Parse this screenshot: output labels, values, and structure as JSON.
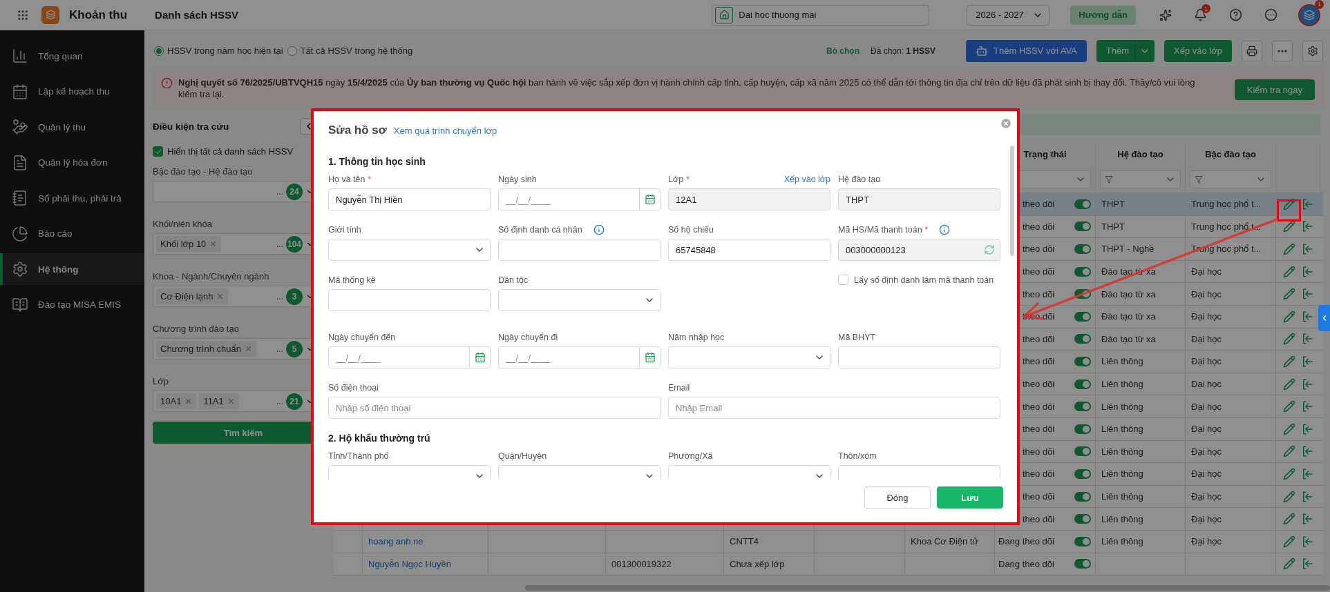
{
  "app": {
    "title": "Khoản thu",
    "page_title": "Danh sách HSSV"
  },
  "top_bar": {
    "school": "Dai hoc thuong mai",
    "year": "2026 - 2027",
    "guide_button": "Hướng dẫn",
    "notification_badge": "1",
    "avatar_badge": "1"
  },
  "sidebar": {
    "items": [
      {
        "kind": "overview",
        "label": "Tổng quan",
        "selected": false
      },
      {
        "kind": "plan",
        "label": "Lập kế hoạch thu",
        "selected": false
      },
      {
        "kind": "collect",
        "label": "Quản lý thu",
        "selected": false
      },
      {
        "kind": "invoice",
        "label": "Quản lý hóa đơn",
        "selected": false
      },
      {
        "kind": "ledger",
        "label": "Sổ phải thu, phải trả",
        "selected": false
      },
      {
        "kind": "report",
        "label": "Báo cáo",
        "selected": false
      },
      {
        "kind": "system",
        "label": "Hệ thống",
        "selected": true
      },
      {
        "kind": "training",
        "label": "Đào tạo MISA EMIS",
        "selected": false
      }
    ]
  },
  "toolbar": {
    "scope_options": [
      {
        "label": "HSSV trong năm học hiện tại",
        "selected": true
      },
      {
        "label": "Tất cả HSSV trong hệ thống",
        "selected": false
      }
    ],
    "clear_selection": "Bỏ chọn",
    "selected_count": "Đã chọn: **1 HSSV**",
    "buttons": [
      {
        "kind": "ava",
        "label": "Thêm HSSV với AVA"
      },
      {
        "kind": "split",
        "label": "Thêm"
      },
      {
        "kind": "primary",
        "label": "Xếp vào lớp"
      }
    ]
  },
  "notice": {
    "text": "**Nghị quyết số 76/2025/UBTVQH15** ngày **15/4/2025** của **Ủy ban thường vụ Quốc hội** ban hành về việc sắp xếp đơn vị hành chính cấp tỉnh, cấp huyện, cấp xã năm 2025 có thể dẫn tới thông tin địa chỉ trên dữ liệu đã phát sinh bị thay đổi. Thầy/cô vui lòng kiểm tra lại.",
    "action": "Kiểm tra ngay"
  },
  "filters": {
    "title": "Điều kiện tra cứu",
    "show_all": {
      "label": "Hiển thị tất cả danh sách HSSV",
      "checked": true
    },
    "fields": [
      {
        "label": "Bậc đào tạo - Hệ đào tạo",
        "more": "...",
        "count": "24"
      },
      {
        "label": "Khối/niên khóa",
        "tags": [
          "Khối lớp 10"
        ],
        "more": "...",
        "count": "104"
      },
      {
        "label": "Khoa - Ngành/Chuyên ngành",
        "tags": [
          "Cơ Điện lạnh"
        ],
        "more": "...",
        "count": "3"
      },
      {
        "label": "Chương trình đào tạo",
        "tags": [
          "Chương trình chuẩn"
        ],
        "more": "...",
        "count": "5"
      },
      {
        "label": "Lớp",
        "tags": [
          "10A1",
          "11A1"
        ],
        "more": "...",
        "count": "21"
      }
    ],
    "search_button": "Tìm kiếm"
  },
  "table": {
    "columns": [
      {
        "label": "Trạng thái"
      },
      {
        "label": "Hệ đào tạo",
        "filter": true
      },
      {
        "label": "Bậc đào tạo",
        "filter": true
      }
    ],
    "rows": [
      {
        "kind": "clipped",
        "selected": true,
        "status": "theo dõi",
        "on": true,
        "training_system": "THPT",
        "education_level": "Trung học phổ t..."
      },
      {
        "kind": "clipped",
        "selected": false,
        "status": "theo dõi",
        "on": true,
        "training_system": "THPT",
        "education_level": "Trung học phổ t..."
      },
      {
        "kind": "clipped",
        "selected": false,
        "status": "theo dõi",
        "on": true,
        "training_system": "THPT - Nghề",
        "education_level": "Trung học phổ t..."
      },
      {
        "kind": "clipped",
        "selected": false,
        "status": "theo dõi",
        "on": true,
        "training_system": "Đào tạo từ xa",
        "education_level": "Đại học"
      },
      {
        "kind": "clipped",
        "selected": false,
        "status": "theo dõi",
        "on": true,
        "training_system": "Đào tạo từ xa",
        "education_level": "Đại học"
      },
      {
        "kind": "clipped",
        "selected": false,
        "status": "theo dõi",
        "on": true,
        "training_system": "Đào tạo từ xa",
        "education_level": "Đại học"
      },
      {
        "kind": "clipped",
        "selected": false,
        "status": "theo dõi",
        "on": true,
        "training_system": "Đào tạo từ xa",
        "education_level": "Đại học"
      },
      {
        "kind": "clipped",
        "selected": false,
        "status": "theo dõi",
        "on": true,
        "training_system": "Liên thông",
        "education_level": "Đại học"
      },
      {
        "kind": "clipped",
        "selected": false,
        "status": "theo dõi",
        "on": true,
        "training_system": "Liên thông",
        "education_level": "Đại học"
      },
      {
        "kind": "clipped",
        "selected": false,
        "status": "theo dõi",
        "on": true,
        "training_system": "Liên thông",
        "education_level": "Đại học"
      },
      {
        "kind": "clipped",
        "selected": false,
        "status": "theo dõi",
        "on": true,
        "training_system": "Liên thông",
        "education_level": "Đại học"
      },
      {
        "kind": "clipped",
        "selected": false,
        "status": "theo dõi",
        "on": true,
        "training_system": "Liên thông",
        "education_level": "Đại học"
      },
      {
        "kind": "clipped",
        "selected": false,
        "status": "theo dõi",
        "on": true,
        "training_system": "Liên thông",
        "education_level": "Đại học"
      },
      {
        "kind": "clipped",
        "selected": false,
        "status": "theo dõi",
        "on": true,
        "training_system": "Liên thông",
        "education_level": "Đại học"
      },
      {
        "kind": "clipped",
        "selected": false,
        "status": "theo dõi",
        "on": true,
        "training_system": "Liên thông",
        "education_level": "Đại học"
      },
      {
        "kind": "full",
        "selected": false,
        "name": "hoang anh ne",
        "class": "CNTT4",
        "department": "Khoa Cơ Điện tử",
        "status": "Đang theo dõi",
        "on": true,
        "training_system": "Liên thông",
        "education_level": "Đại học"
      },
      {
        "kind": "full",
        "selected": false,
        "name": "Nguyễn Ngọc Huyền",
        "column_4": "001300019322",
        "class": "Chưa xếp lớp",
        "status": "Đang theo dõi",
        "on": true
      }
    ]
  },
  "dialog": {
    "title": "Sửa hồ sơ",
    "history_link": "Xem quá trình chuyển lớp",
    "sections": [
      {
        "title": "1. Thông tin học sinh",
        "rows": [
          [
            {
              "kind": "text",
              "label": "Họ và tên",
              "required_mark": "*",
              "value": "Nguyễn Thị Hiền"
            },
            {
              "kind": "date",
              "label": "Ngày sinh",
              "placeholder": "__/__/____"
            },
            {
              "kind": "readonly",
              "label": "Lớp",
              "required_mark": "*",
              "link": "Xếp vào lớp",
              "value": "12A1"
            },
            {
              "kind": "readonly",
              "label": "Hệ đào tạo",
              "value": "THPT"
            }
          ],
          [
            {
              "kind": "select",
              "label": "Giới tính"
            },
            {
              "kind": "text",
              "label": "Số định danh cá nhân",
              "info": true
            },
            {
              "kind": "text",
              "label": "Số hộ chiếu",
              "value": "65745848"
            },
            {
              "kind": "code",
              "label": "Mã HS/Mã thanh toán",
              "required_mark": "*",
              "info": true,
              "value": "003000000123"
            }
          ],
          [
            {
              "kind": "text",
              "label": "Mã thống kê"
            },
            {
              "kind": "select",
              "label": "Dân tộc"
            },
            "",
            {
              "kind": "checkbox",
              "label": "Lấy số định danh làm mã thanh toán",
              "checked": false
            }
          ],
          [
            {
              "kind": "date",
              "label": "Ngày chuyển đến",
              "placeholder": "__/__/____"
            },
            {
              "kind": "date",
              "label": "Ngày chuyển đi",
              "placeholder": "__/__/____"
            },
            {
              "kind": "select",
              "label": "Năm nhập học"
            },
            {
              "kind": "text",
              "label": "Mã BHYT"
            }
          ],
          [
            {
              "kind": "text",
              "label": "Số điện thoại",
              "placeholder": "Nhập số điện thoại"
            },
            "",
            {
              "kind": "text",
              "label": "Email",
              "placeholder": "Nhập Email"
            },
            ""
          ]
        ]
      },
      {
        "title": "2. Hộ khẩu thường trú",
        "rows": [
          [
            {
              "kind": "select",
              "label": "Tỉnh/Thành phố"
            },
            {
              "kind": "select",
              "label": "Quận/Huyện"
            },
            {
              "kind": "select",
              "label": "Phường/Xã"
            },
            {
              "kind": "text",
              "label": "Thôn/xóm"
            }
          ]
        ]
      }
    ],
    "buttons": [
      {
        "kind": "secondary",
        "label": "Đóng"
      },
      {
        "kind": "primary",
        "label": "Lưu"
      }
    ]
  }
}
